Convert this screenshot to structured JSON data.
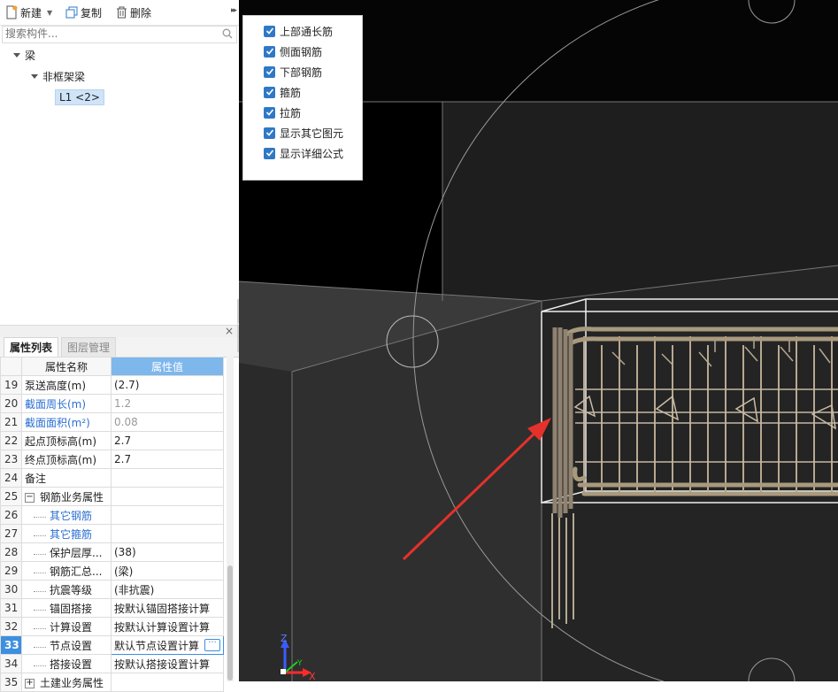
{
  "toolbar": {
    "new_label": "新建",
    "copy_label": "复制",
    "delete_label": "删除",
    "more_glyph": "▸▸"
  },
  "search": {
    "placeholder": "搜索构件..."
  },
  "tree": {
    "root": "梁",
    "child": "非框架梁",
    "leaf": "L1 <2>"
  },
  "panel": {
    "close_glyph": "×",
    "tabs": [
      {
        "label": "属性列表"
      },
      {
        "label": "图层管理"
      }
    ],
    "headers": {
      "name": "属性名称",
      "value": "属性值"
    }
  },
  "rows": [
    {
      "num": "19",
      "name": "泵送高度(m)",
      "value": "(2.7)"
    },
    {
      "num": "20",
      "name": "截面周长(m)",
      "value": "1.2"
    },
    {
      "num": "21",
      "name": "截面面积(m²)",
      "value": "0.08"
    },
    {
      "num": "22",
      "name": "起点顶标高(m)",
      "value": "2.7"
    },
    {
      "num": "23",
      "name": "终点顶标高(m)",
      "value": "2.7"
    },
    {
      "num": "24",
      "name": "备注",
      "value": ""
    },
    {
      "num": "25",
      "name": "钢筋业务属性",
      "value": "",
      "toggle": "−"
    },
    {
      "num": "26",
      "name": "其它钢筋",
      "value": ""
    },
    {
      "num": "27",
      "name": "其它箍筋",
      "value": ""
    },
    {
      "num": "28",
      "name": "保护层厚...",
      "value": "(38)"
    },
    {
      "num": "29",
      "name": "钢筋汇总...",
      "value": "(梁)"
    },
    {
      "num": "30",
      "name": "抗震等级",
      "value": "(非抗震)"
    },
    {
      "num": "31",
      "name": "锚固搭接",
      "value": "按默认锚固搭接计算"
    },
    {
      "num": "32",
      "name": "计算设置",
      "value": "按默认计算设置计算"
    },
    {
      "num": "33",
      "name": "节点设置",
      "value": "默认节点设置计算",
      "edit_glyph": "···"
    },
    {
      "num": "34",
      "name": "搭接设置",
      "value": "按默认搭接设置计算"
    },
    {
      "num": "35",
      "name": "土建业务属性",
      "value": "",
      "toggle": "+"
    }
  ],
  "display_options": [
    {
      "label": "上部通长筋",
      "checked": true
    },
    {
      "label": "侧面钢筋",
      "checked": true
    },
    {
      "label": "下部钢筋",
      "checked": true
    },
    {
      "label": "箍筋",
      "checked": true
    },
    {
      "label": "拉筋",
      "checked": true
    },
    {
      "label": "显示其它图元",
      "checked": true
    },
    {
      "label": "显示详细公式",
      "checked": true
    }
  ],
  "axes": {
    "z": "Z",
    "y": "Y",
    "x": "X"
  },
  "colors": {
    "accent": "#2f78c7",
    "header_value_bg": "#7db7ec",
    "selected_row": "#3d8fe0",
    "link_text": "#2b6fd3",
    "arrow": "#e5312b",
    "rebar": "#b8a890"
  }
}
